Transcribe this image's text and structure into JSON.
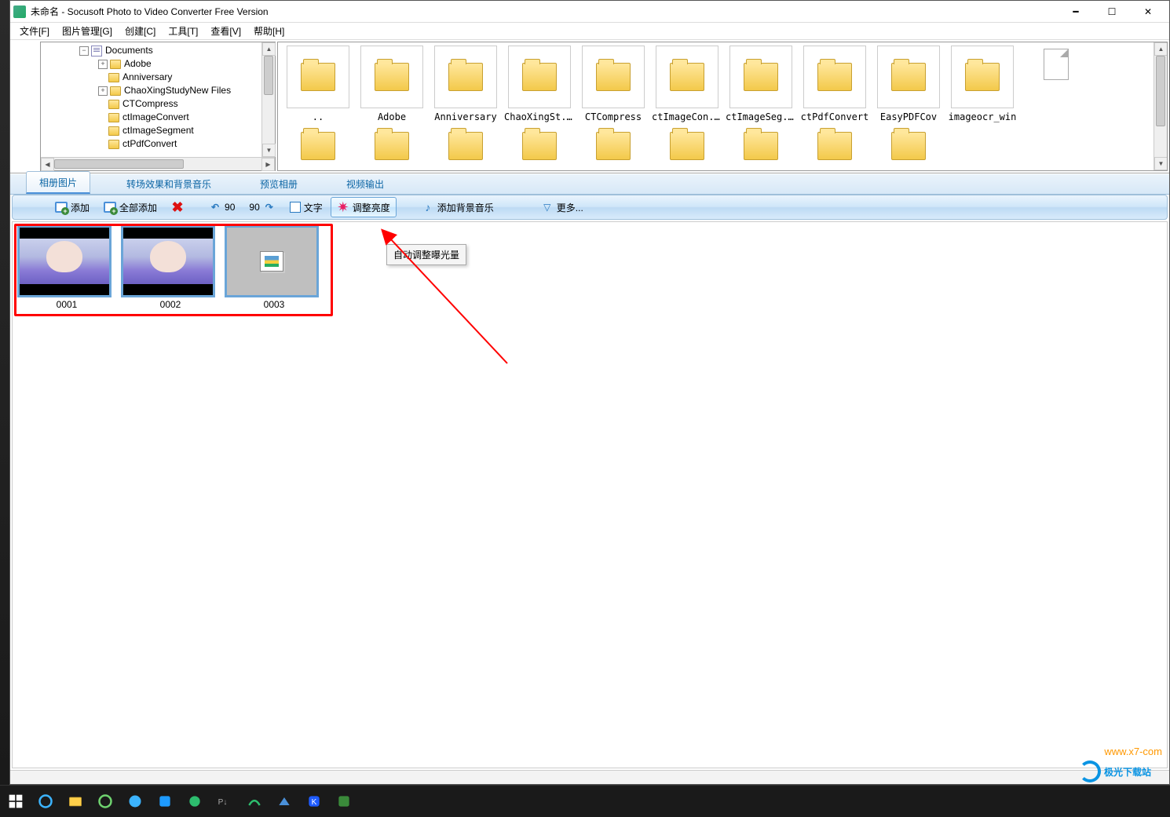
{
  "window": {
    "title": "未命名 - Socusoft Photo to Video Converter Free Version"
  },
  "menu": {
    "file": "文件[F]",
    "image_mgmt": "图片管理[G]",
    "create": "创建[C]",
    "tools": "工具[T]",
    "view": "查看[V]",
    "help": "帮助[H]"
  },
  "tree": {
    "root": "Documents",
    "items": [
      "Adobe",
      "Anniversary",
      "ChaoXingStudyNew Files",
      "CTCompress",
      "ctImageConvert",
      "ctImageSegment",
      "ctPdfConvert"
    ]
  },
  "folders": {
    "row1": [
      {
        "label": "..",
        "type": "folder"
      },
      {
        "label": "Adobe",
        "type": "folder"
      },
      {
        "label": "Anniversary",
        "type": "folder"
      },
      {
        "label": "ChaoXingSt...",
        "type": "folder"
      },
      {
        "label": "CTCompress",
        "type": "folder"
      },
      {
        "label": "ctImageCon...",
        "type": "folder"
      },
      {
        "label": "ctImageSeg...",
        "type": "folder"
      },
      {
        "label": "ctPdfConvert",
        "type": "folder"
      },
      {
        "label": "EasyPDFCov",
        "type": "folder"
      },
      {
        "label": "imageocr_win",
        "type": "folder"
      }
    ],
    "row2": [
      {
        "label": "",
        "type": "file"
      },
      {
        "label": "",
        "type": "folder"
      },
      {
        "label": "",
        "type": "folder"
      },
      {
        "label": "",
        "type": "folder"
      },
      {
        "label": "",
        "type": "folder"
      },
      {
        "label": "",
        "type": "folder"
      },
      {
        "label": "",
        "type": "folder"
      },
      {
        "label": "",
        "type": "folder"
      },
      {
        "label": "",
        "type": "folder"
      },
      {
        "label": "",
        "type": "folder"
      }
    ]
  },
  "tabs": {
    "album_photos": "相册图片",
    "transition_music": "转场效果和背景音乐",
    "preview_album": "预览相册",
    "video_output": "视频输出"
  },
  "toolbar": {
    "add": "添加",
    "add_all": "全部添加",
    "rotate_left": "90",
    "rotate_right": "90",
    "text": "文字",
    "brightness": "调整亮度",
    "add_music": "添加背景音乐",
    "more": "更多..."
  },
  "thumbs": [
    {
      "label": "0001",
      "kind": "photo"
    },
    {
      "label": "0002",
      "kind": "photo"
    },
    {
      "label": "0003",
      "kind": "placeholder"
    }
  ],
  "tooltip": "自动调整曝光量",
  "watermark1": "极光下载站",
  "watermark2": "www.x7-com"
}
